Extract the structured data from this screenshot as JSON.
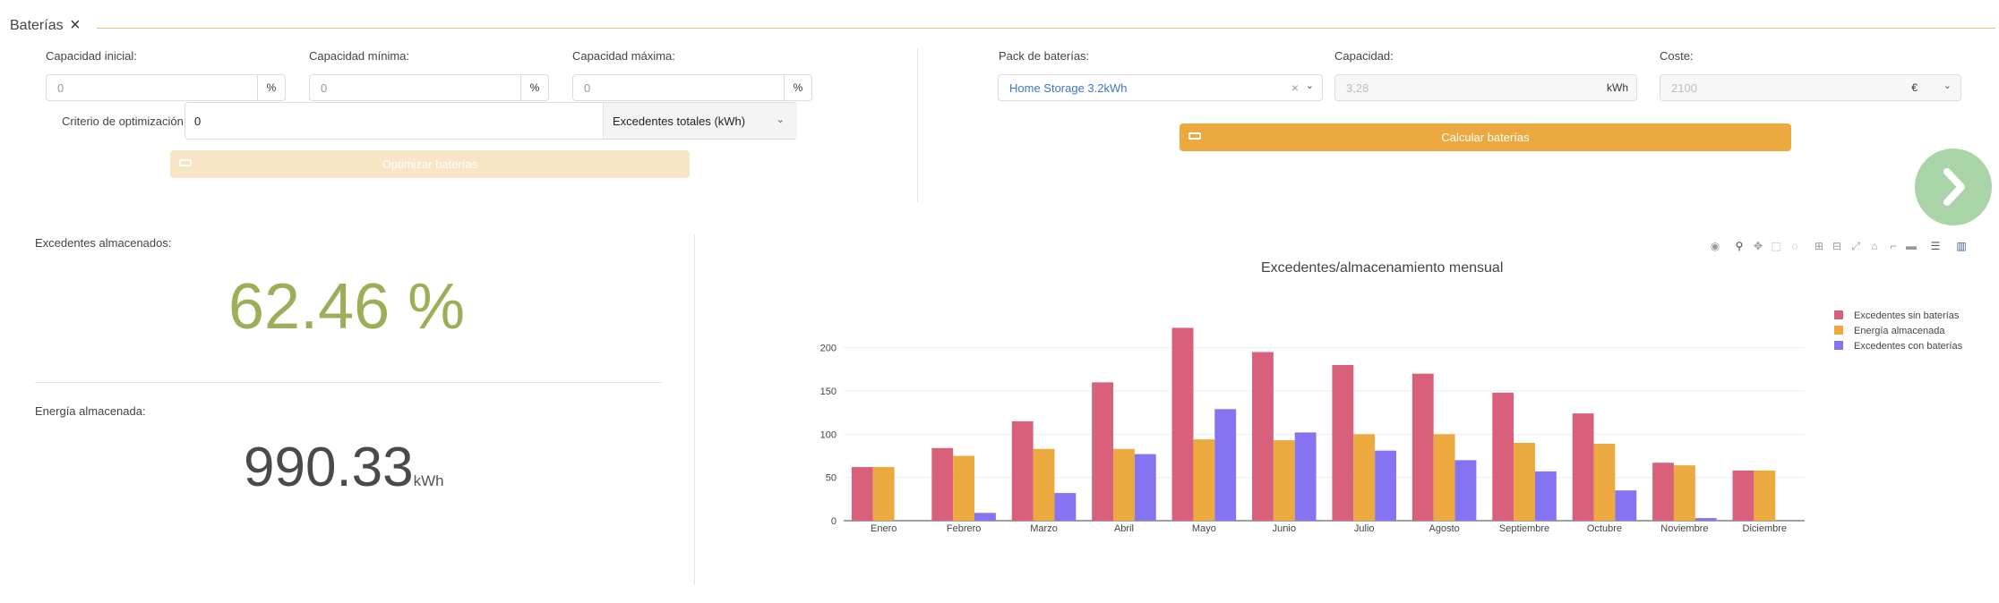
{
  "panel": {
    "title": "Baterías",
    "close_icon": "×"
  },
  "left_form": {
    "cap_inicial": {
      "label": "Capacidad inicial:",
      "placeholder": "0",
      "unit": "%"
    },
    "cap_minima": {
      "label": "Capacidad mínima:",
      "placeholder": "0",
      "unit": "%"
    },
    "cap_maxima": {
      "label": "Capacidad máxima:",
      "placeholder": "0",
      "unit": "%"
    },
    "criterio": {
      "label": "Criterio de optimización:",
      "value": "0",
      "select": "Excedentes totales (kWh)"
    },
    "optimize_button": "Optimizar baterías"
  },
  "right_form": {
    "pack": {
      "label": "Pack de baterías:",
      "value": "Home Storage 3.2kWh"
    },
    "capacidad": {
      "label": "Capacidad:",
      "value": "3,28",
      "unit": "kWh"
    },
    "coste": {
      "label": "Coste:",
      "value": "2100",
      "currency": "€"
    },
    "calc_button": "Calcular baterías"
  },
  "stats": {
    "excedentes_label": "Excedentes almacenados:",
    "excedentes_value": "62.46 %",
    "energia_label": "Energía almacenada:",
    "energia_value": "990.33",
    "energia_unit": "kWh"
  },
  "colors": {
    "accent": "#eba93f",
    "pink": "#d9607a",
    "orange": "#eba93f",
    "purple": "#8573f2",
    "green": "#9aaf58"
  },
  "chart_data": {
    "type": "bar",
    "title": "Excedentes/almacenamiento mensual",
    "categories": [
      "Enero",
      "Febrero",
      "Marzo",
      "Abril",
      "Mayo",
      "Junio",
      "Julio",
      "Agosto",
      "Septiembre",
      "Octubre",
      "Noviembre",
      "Diciembre"
    ],
    "yticks": [
      0,
      50,
      100,
      150,
      200
    ],
    "ylim": [
      0,
      240
    ],
    "legend_position": "top-right",
    "series": [
      {
        "name": "Excedentes sin baterías",
        "color": "#d9607a",
        "values": [
          62,
          84,
          115,
          160,
          223,
          195,
          180,
          170,
          148,
          124,
          67,
          58
        ]
      },
      {
        "name": "Energía almacenada",
        "color": "#eba93f",
        "values": [
          62,
          75,
          83,
          83,
          94,
          93,
          100,
          100,
          90,
          89,
          64,
          58
        ]
      },
      {
        "name": "Excedentes con baterías",
        "color": "#8573f2",
        "values": [
          0,
          9,
          32,
          77,
          129,
          102,
          81,
          70,
          57,
          35,
          3,
          0
        ]
      }
    ]
  }
}
